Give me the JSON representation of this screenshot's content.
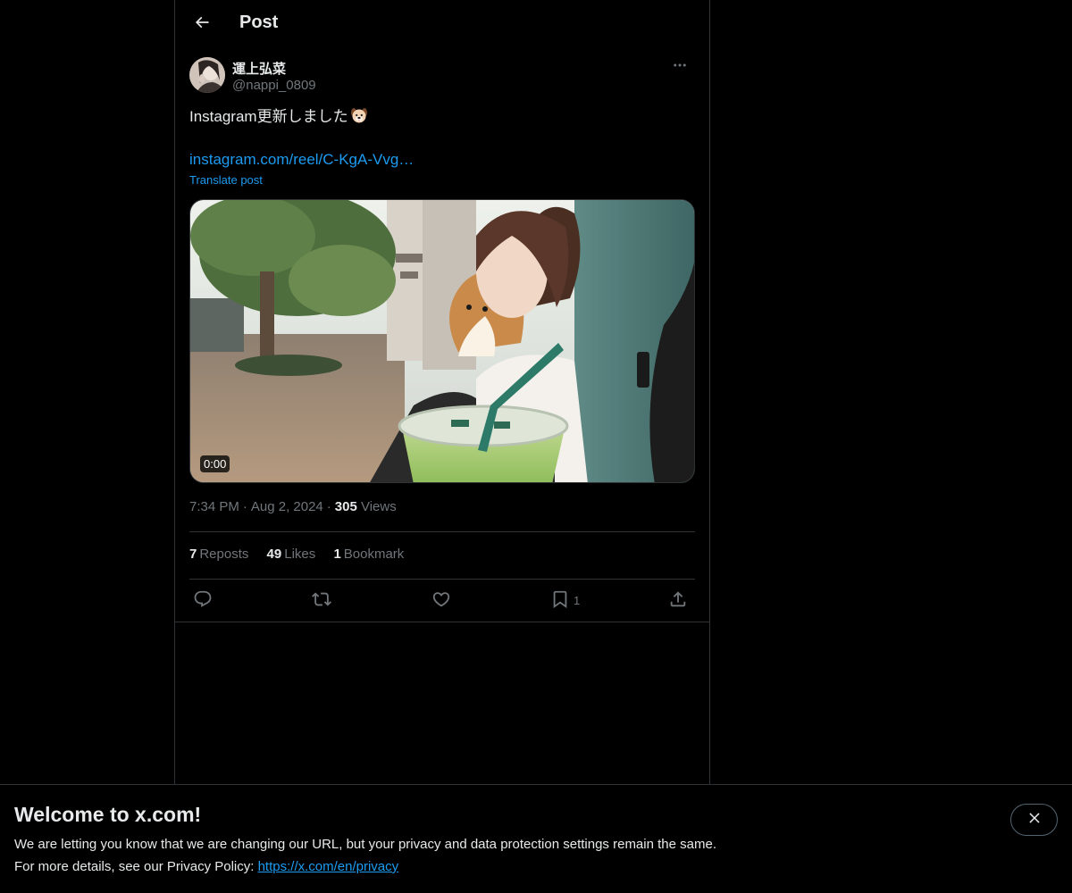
{
  "header": {
    "title": "Post"
  },
  "post": {
    "author": {
      "display_name": "運上弘菜",
      "handle": "@nappi_0809"
    },
    "text": "Instagram更新しました",
    "emoji": "dog-face",
    "link_text": "instagram.com/reel/C-KgA-Vvg…",
    "translate_label": "Translate post",
    "media": {
      "duration": "0:00"
    },
    "time": "7:34 PM",
    "date": "Aug 2, 2024",
    "views_count": "305",
    "views_label": "Views",
    "stats": {
      "reposts_count": "7",
      "reposts_label": "Reposts",
      "likes_count": "49",
      "likes_label": "Likes",
      "bookmarks_count": "1",
      "bookmarks_label": "Bookmark"
    },
    "actions": {
      "bookmark_count": "1"
    }
  },
  "banner": {
    "title": "Welcome to x.com!",
    "line1": "We are letting you know that we are changing our URL, but your privacy and data protection settings remain the same.",
    "line2_prefix": "For more details, see our Privacy Policy: ",
    "link": "https://x.com/en/privacy"
  },
  "colors": {
    "accent": "#1d9bf0",
    "background": "#000000",
    "text_primary": "#e7e9ea",
    "text_secondary": "#71767b",
    "border": "#2f3336"
  }
}
